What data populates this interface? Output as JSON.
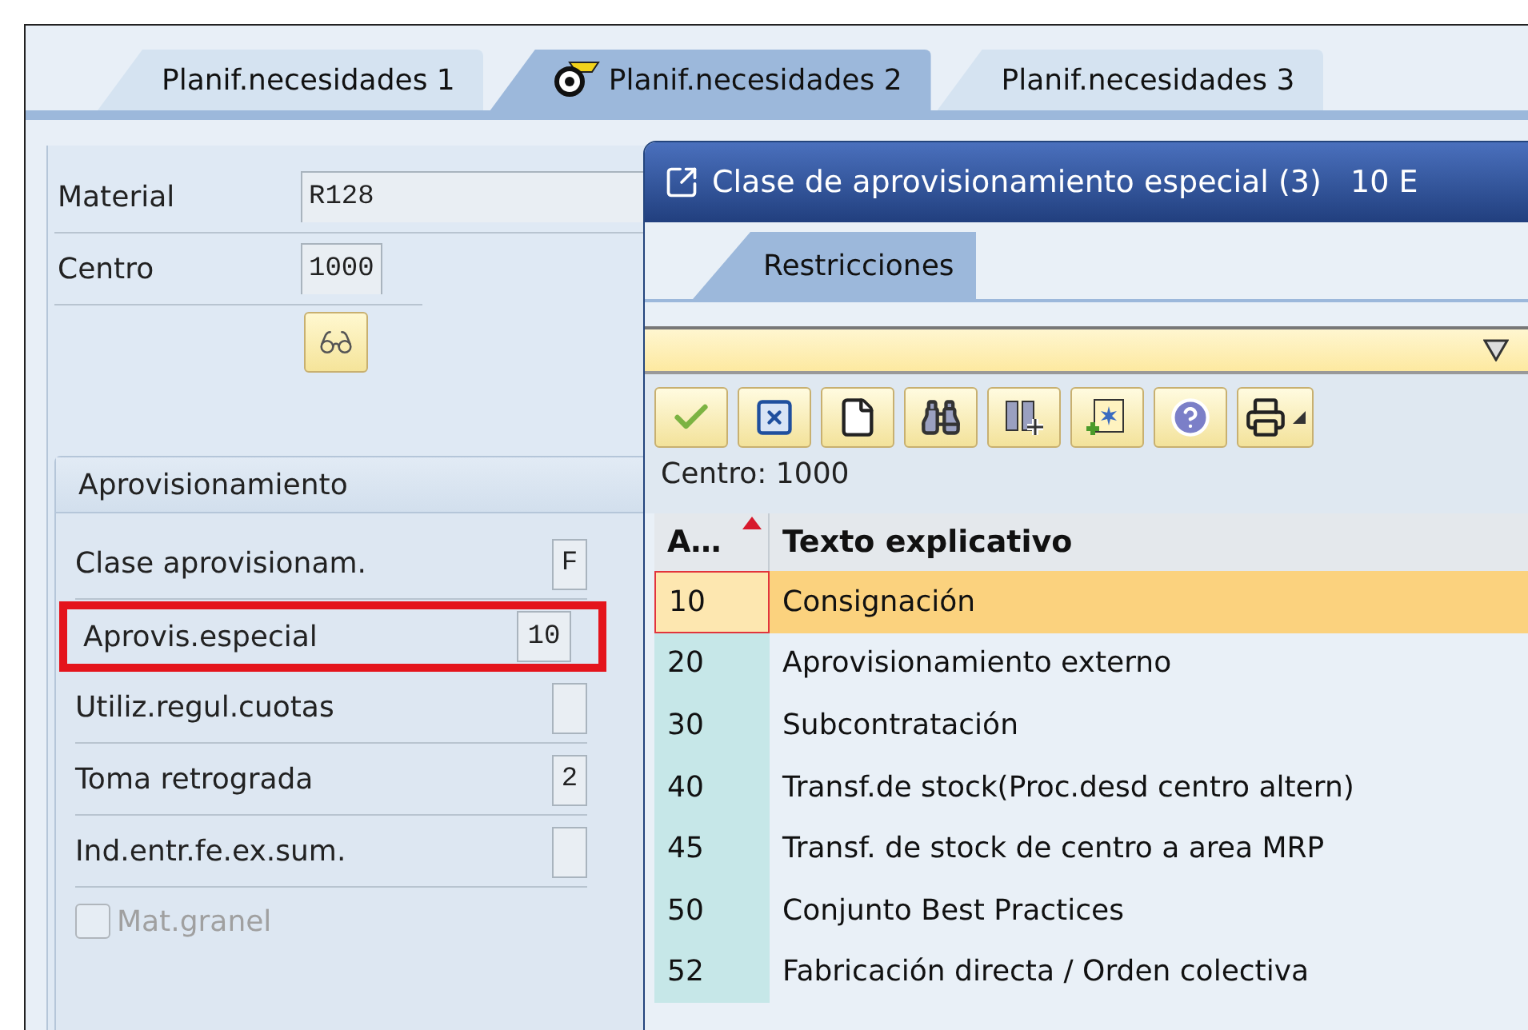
{
  "tabs": [
    {
      "label": "Planif.necesidades 1",
      "selected": false
    },
    {
      "label": "Planif.necesidades 2",
      "selected": true
    },
    {
      "label": "Planif.necesidades 3",
      "selected": false
    }
  ],
  "header_fields": [
    {
      "label": "Material",
      "value": "R128",
      "kind": "wide"
    },
    {
      "label": "Centro",
      "value": "1000",
      "kind": "short"
    }
  ],
  "group": {
    "title": "Aprovisionamiento",
    "fields": [
      {
        "label": "Clase aprovisionam.",
        "value": "F",
        "highlighted": false
      },
      {
        "label": "Aprovis.especial",
        "value": "10",
        "highlighted": true
      },
      {
        "label": "Utiliz.regul.cuotas",
        "highlighted": false
      },
      {
        "label": "Toma retrograda",
        "value": "2",
        "highlighted": false
      },
      {
        "label": "Ind.entr.fe.ex.sum.",
        "highlighted": false
      }
    ],
    "checkbox": {
      "label": "Mat.granel",
      "checked": false,
      "disabled": true
    }
  },
  "dialog": {
    "title": "Clase de aprovisionamiento especial (3)   10 E",
    "tab": {
      "label": "Restricciones",
      "selected": true
    },
    "info": "Centro: 1000",
    "table": {
      "columns": [
        "A…",
        "Texto explicativo"
      ],
      "rows": [
        {
          "key": "10",
          "text": "Consignación",
          "selected": true
        },
        {
          "key": "20",
          "text": "Aprovisionamiento externo",
          "selected": false
        },
        {
          "key": "30",
          "text": "Subcontratación",
          "selected": false
        },
        {
          "key": "40",
          "text": "Transf.de stock(Proc.desd centro altern)",
          "selected": false
        },
        {
          "key": "45",
          "text": "Transf. de stock de centro a area MRP",
          "selected": false
        },
        {
          "key": "50",
          "text": "Conjunto Best Practices",
          "selected": false
        },
        {
          "key": "52",
          "text": "Fabricación directa / Orden colectiva",
          "selected": false
        }
      ]
    }
  }
}
